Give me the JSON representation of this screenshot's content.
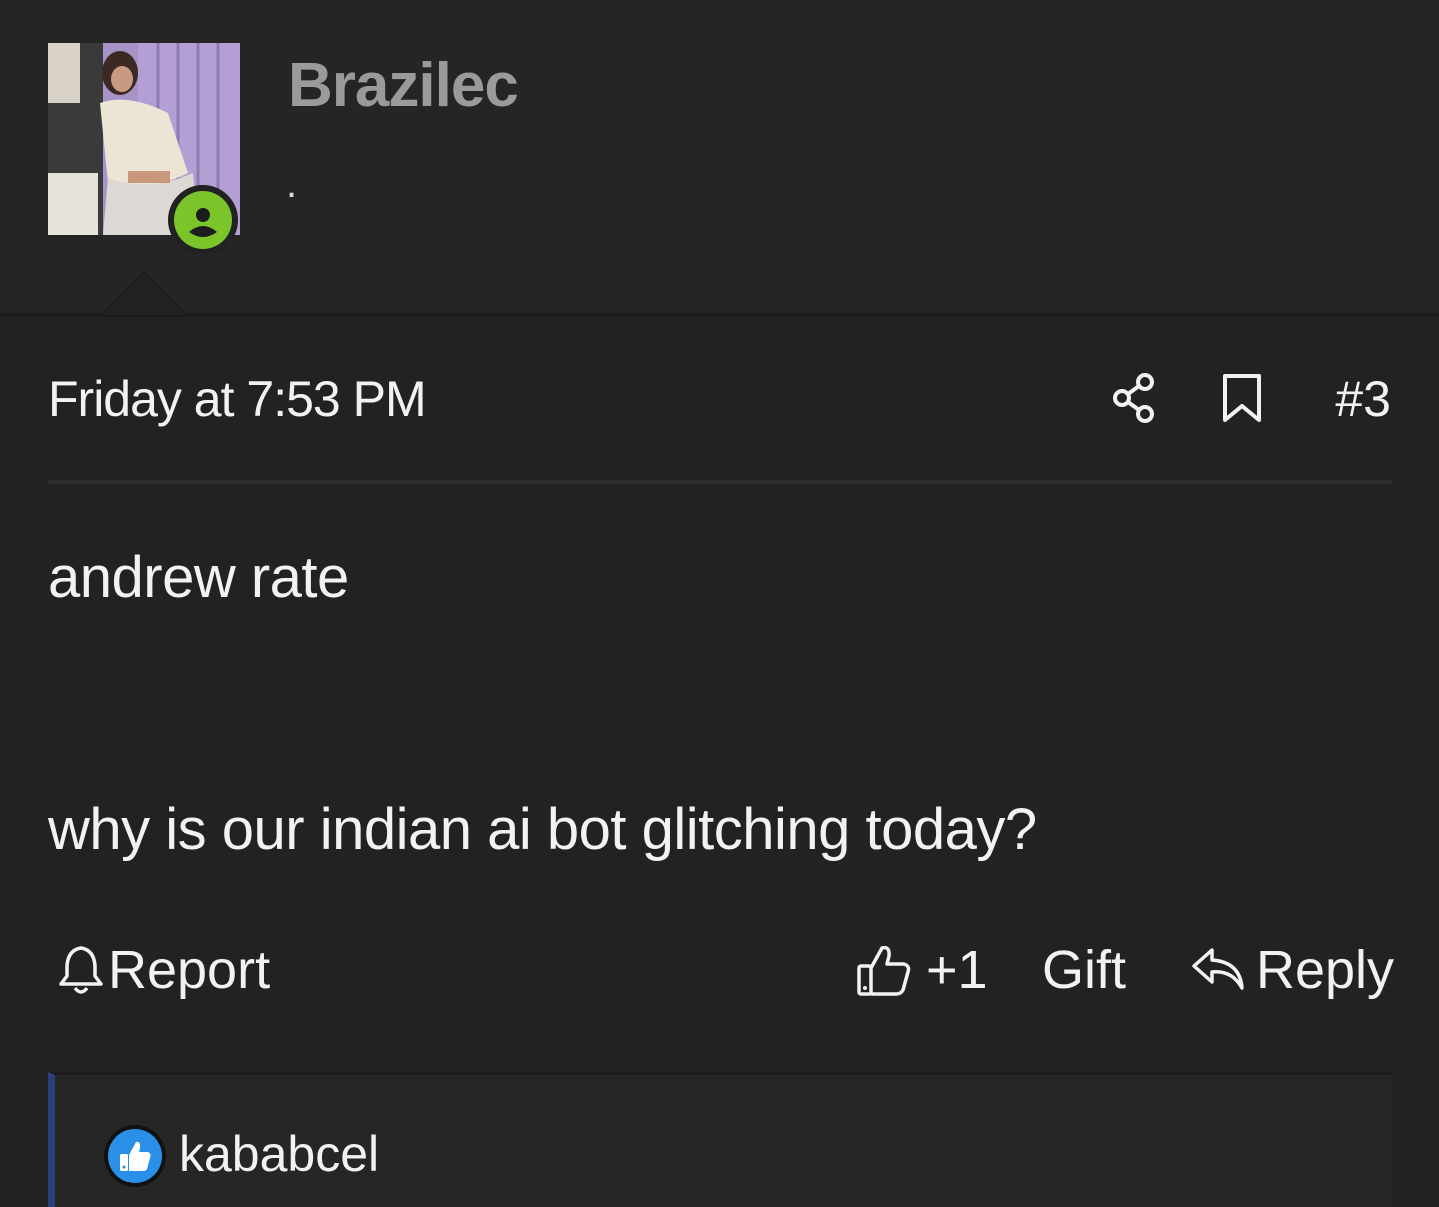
{
  "user": {
    "name": "Brazilec",
    "title": ".",
    "avatar_icon": "user-avatar-photo",
    "status_icon": "online-user-icon",
    "status_color": "#7bc42a"
  },
  "post": {
    "date": "Friday at 7:53 PM",
    "number": "#3",
    "share_icon": "share-icon",
    "bookmark_icon": "bookmark-icon",
    "lines": [
      "andrew rate",
      "why is our indian ai bot glitching today?"
    ]
  },
  "actions": {
    "report_label": "Report",
    "report_icon": "bell-icon",
    "like_label": "+1",
    "like_icon": "thumbs-up-icon",
    "gift_label": "Gift",
    "reply_label": "Reply",
    "reply_icon": "reply-arrow-icon"
  },
  "reactions": {
    "icon": "like-reaction-icon",
    "icon_color": "#2a8fe6",
    "accent_color": "#2a3f7a",
    "users": "kababcel"
  }
}
